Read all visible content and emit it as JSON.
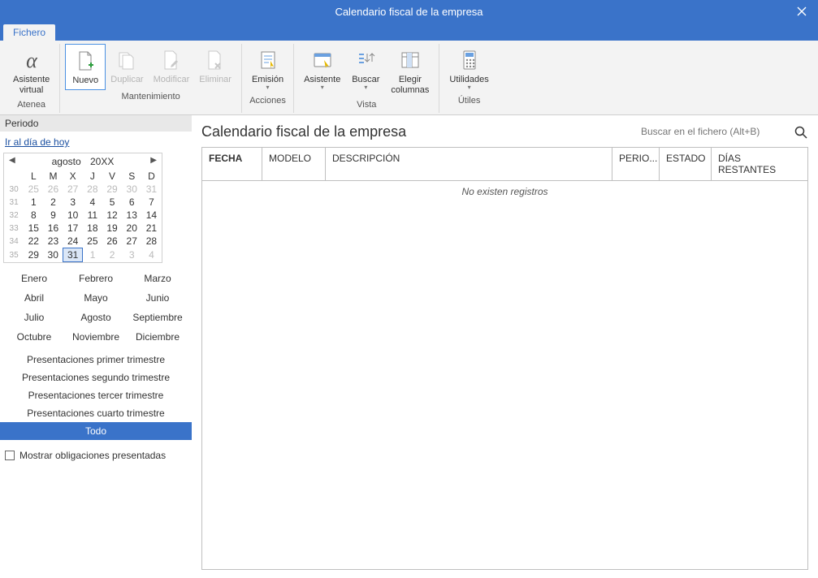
{
  "titlebar": {
    "title": "Calendario fiscal de la empresa"
  },
  "menubar": {
    "file": "Fichero"
  },
  "ribbon": {
    "atenea": {
      "line1": "Asistente",
      "line2": "virtual",
      "group": "Atenea"
    },
    "mant": {
      "nuevo": "Nuevo",
      "duplicar": "Duplicar",
      "modificar": "Modificar",
      "eliminar": "Eliminar",
      "group": "Mantenimiento"
    },
    "acciones": {
      "emision": "Emisión",
      "group": "Acciones"
    },
    "vista": {
      "asistente": "Asistente",
      "buscar": "Buscar",
      "elegir1": "Elegir",
      "elegir2": "columnas",
      "group": "Vista"
    },
    "utiles": {
      "utilidades": "Utilidades",
      "group": "Útiles"
    }
  },
  "sidebar": {
    "periodo": "Periodo",
    "today": "Ir al día de hoy",
    "month": "agosto",
    "year": "20XX",
    "dow": [
      "L",
      "M",
      "X",
      "J",
      "V",
      "S",
      "D"
    ],
    "weeks": [
      {
        "wk": "30",
        "days": [
          {
            "d": "25",
            "o": true
          },
          {
            "d": "26",
            "o": true
          },
          {
            "d": "27",
            "o": true
          },
          {
            "d": "28",
            "o": true
          },
          {
            "d": "29",
            "o": true
          },
          {
            "d": "30",
            "o": true
          },
          {
            "d": "31",
            "o": true
          }
        ]
      },
      {
        "wk": "31",
        "days": [
          {
            "d": "1"
          },
          {
            "d": "2"
          },
          {
            "d": "3"
          },
          {
            "d": "4"
          },
          {
            "d": "5"
          },
          {
            "d": "6"
          },
          {
            "d": "7"
          }
        ]
      },
      {
        "wk": "32",
        "days": [
          {
            "d": "8"
          },
          {
            "d": "9"
          },
          {
            "d": "10"
          },
          {
            "d": "11"
          },
          {
            "d": "12"
          },
          {
            "d": "13"
          },
          {
            "d": "14"
          }
        ]
      },
      {
        "wk": "33",
        "days": [
          {
            "d": "15"
          },
          {
            "d": "16"
          },
          {
            "d": "17"
          },
          {
            "d": "18"
          },
          {
            "d": "19"
          },
          {
            "d": "20"
          },
          {
            "d": "21"
          }
        ]
      },
      {
        "wk": "34",
        "days": [
          {
            "d": "22"
          },
          {
            "d": "23"
          },
          {
            "d": "24"
          },
          {
            "d": "25"
          },
          {
            "d": "26"
          },
          {
            "d": "27"
          },
          {
            "d": "28"
          }
        ]
      },
      {
        "wk": "35",
        "days": [
          {
            "d": "29"
          },
          {
            "d": "30"
          },
          {
            "d": "31",
            "today": true
          },
          {
            "d": "1",
            "o": true
          },
          {
            "d": "2",
            "o": true
          },
          {
            "d": "3",
            "o": true
          },
          {
            "d": "4",
            "o": true
          }
        ]
      }
    ],
    "months": [
      "Enero",
      "Febrero",
      "Marzo",
      "Abril",
      "Mayo",
      "Junio",
      "Julio",
      "Agosto",
      "Septiembre",
      "Octubre",
      "Noviembre",
      "Diciembre"
    ],
    "pres": [
      "Presentaciones primer trimestre",
      "Presentaciones segundo trimestre",
      "Presentaciones tercer trimestre",
      "Presentaciones cuarto trimestre",
      "Todo"
    ],
    "chk": "Mostrar obligaciones presentadas"
  },
  "main": {
    "title": "Calendario fiscal de la empresa",
    "search_placeholder": "Buscar en el fichero (Alt+B)",
    "cols": {
      "fecha": "FECHA",
      "modelo": "MODELO",
      "desc": "DESCRIPCIÓN",
      "perio": "PERIO...",
      "estado": "ESTADO",
      "dias": "DÍAS RESTANTES"
    },
    "empty": "No existen registros"
  }
}
